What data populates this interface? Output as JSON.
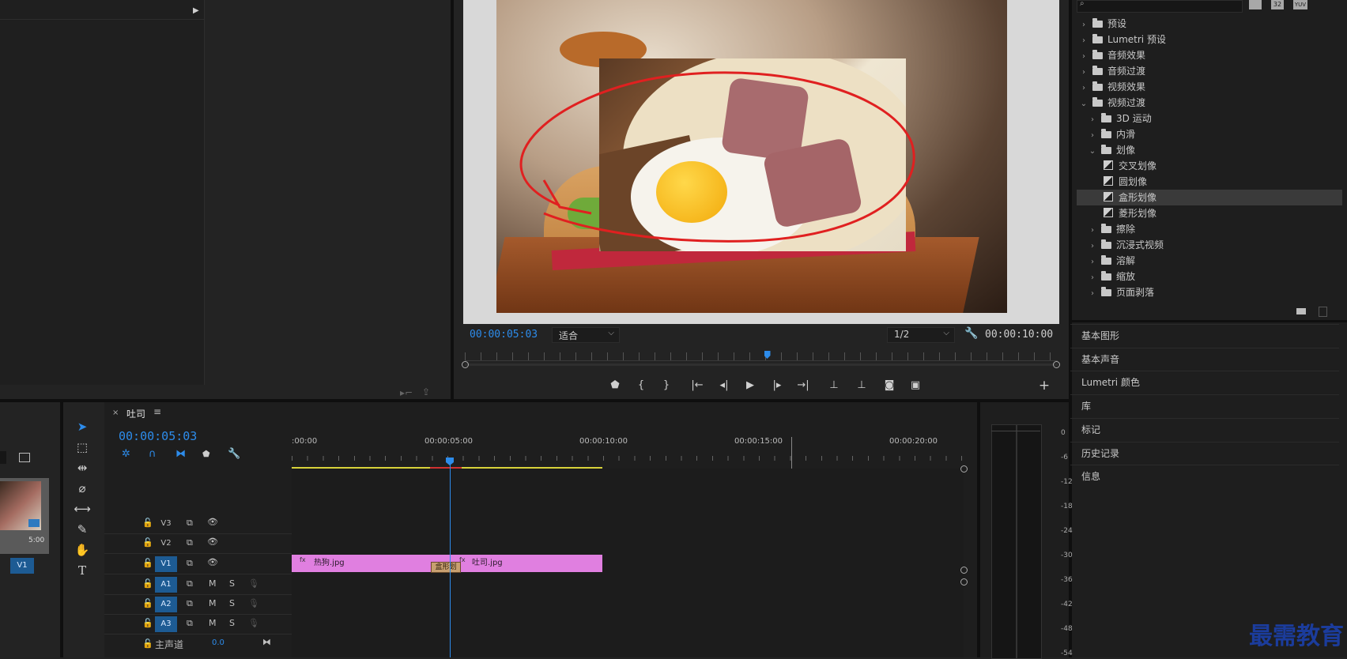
{
  "program_monitor": {
    "timecode": "00:00:05:03",
    "fit_label": "适合",
    "resolution": "1/2",
    "duration": "00:00:10:00",
    "playhead_fraction": 0.51
  },
  "effects_panel": {
    "search_placeholder": "",
    "toolbar_badges": [
      "32",
      "YUV"
    ],
    "items": [
      {
        "label": "预设",
        "level": 0,
        "type": "folder-star",
        "expanded": false
      },
      {
        "label": "Lumetri 预设",
        "level": 0,
        "type": "folder-star",
        "expanded": false
      },
      {
        "label": "音频效果",
        "level": 0,
        "type": "folder",
        "expanded": false
      },
      {
        "label": "音频过渡",
        "level": 0,
        "type": "folder",
        "expanded": false
      },
      {
        "label": "视频效果",
        "level": 0,
        "type": "folder",
        "expanded": false
      },
      {
        "label": "视频过渡",
        "level": 0,
        "type": "folder",
        "expanded": true
      },
      {
        "label": "3D 运动",
        "level": 1,
        "type": "folder",
        "expanded": false
      },
      {
        "label": "内滑",
        "level": 1,
        "type": "folder",
        "expanded": false
      },
      {
        "label": "划像",
        "level": 1,
        "type": "folder",
        "expanded": true
      },
      {
        "label": "交叉划像",
        "level": 2,
        "type": "effect"
      },
      {
        "label": "圆划像",
        "level": 2,
        "type": "effect"
      },
      {
        "label": "盒形划像",
        "level": 2,
        "type": "effect",
        "selected": true
      },
      {
        "label": "菱形划像",
        "level": 2,
        "type": "effect"
      },
      {
        "label": "擦除",
        "level": 1,
        "type": "folder",
        "expanded": false
      },
      {
        "label": "沉浸式视频",
        "level": 1,
        "type": "folder",
        "expanded": false
      },
      {
        "label": "溶解",
        "level": 1,
        "type": "folder",
        "expanded": false
      },
      {
        "label": "缩放",
        "level": 1,
        "type": "folder",
        "expanded": false
      },
      {
        "label": "页面剥落",
        "level": 1,
        "type": "folder",
        "expanded": false
      }
    ]
  },
  "side_panels": [
    "基本图形",
    "基本声音",
    "Lumetri 颜色",
    "库",
    "标记",
    "历史记录",
    "信息"
  ],
  "project_panel": {
    "thumb_duration": "5:00"
  },
  "timeline": {
    "sequence_name": "吐司",
    "timecode": "00:00:05:03",
    "ruler_labels": [
      ":00:00",
      "00:00:05:00",
      "00:00:10:00",
      "00:00:15:00",
      "00:00:20:00"
    ],
    "tracks_video": [
      "V3",
      "V2",
      "V1"
    ],
    "tracks_audio": [
      "A1",
      "A2",
      "A3"
    ],
    "source_patch": "V1",
    "master_label": "主声道",
    "master_value": "0.0",
    "clips": [
      {
        "name": "热狗.jpg",
        "fx": "fx"
      },
      {
        "name": "吐司.jpg",
        "fx": "fx"
      }
    ],
    "transition_label": "盒形划"
  },
  "audio_meter": {
    "labels": [
      "0",
      "-6",
      "-12",
      "-18",
      "-24",
      "-30",
      "-36",
      "-42",
      "-48",
      "-54"
    ]
  },
  "watermark": "最需教育",
  "colors": {
    "accent_blue": "#2d8ceb",
    "clip_pink": "#e07fe0",
    "selected_track": "#1d5b93",
    "annotation_red": "#e02020"
  }
}
